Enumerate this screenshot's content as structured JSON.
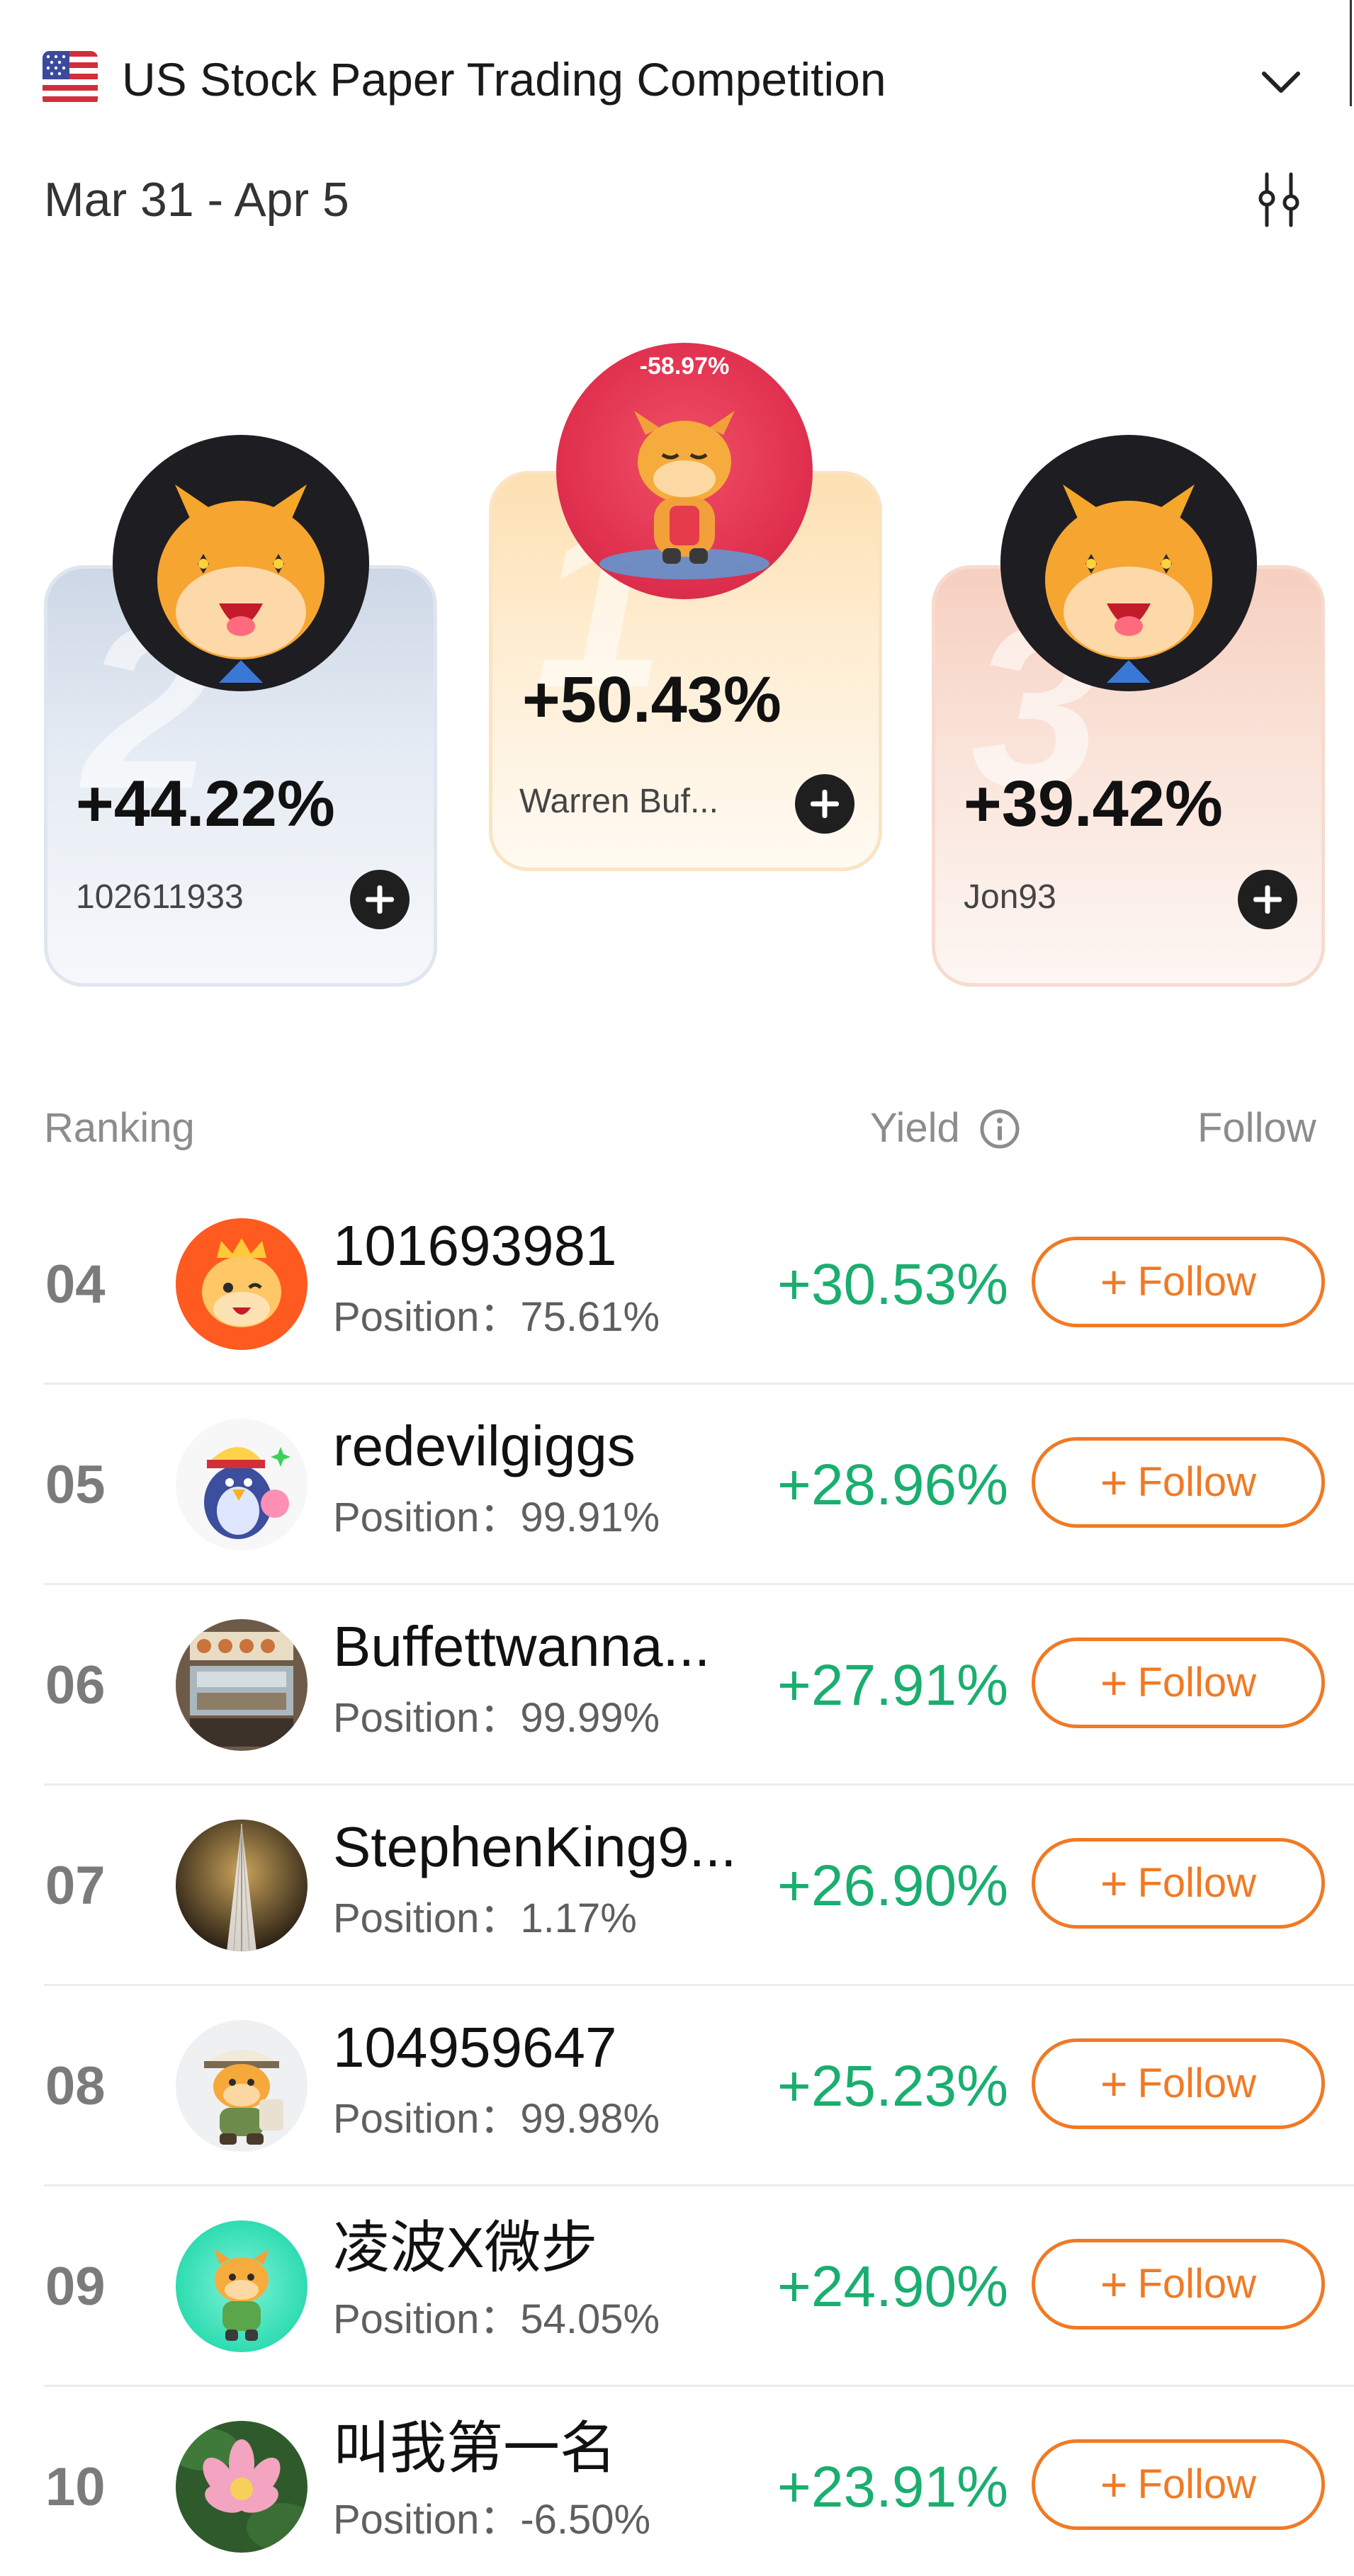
{
  "header": {
    "title": "US Stock Paper Trading Competition",
    "date_range": "Mar 31 - Apr 5",
    "flag_icon": "us-flag-icon",
    "dropdown_icon": "chevron-down-icon",
    "filter_icon": "sliders-icon"
  },
  "podium": [
    {
      "rank": "2",
      "yield": "+44.22%",
      "name": "102611933",
      "avatar": "bull-mascot-icon"
    },
    {
      "rank": "1",
      "yield": "+50.43%",
      "name": "Warren Buf...",
      "avatar": "bull-figure-image",
      "avatar_caption": "-58.97%"
    },
    {
      "rank": "3",
      "yield": "+39.42%",
      "name": "Jon93",
      "avatar": "bull-mascot-icon"
    }
  ],
  "list_header": {
    "ranking": "Ranking",
    "yield": "Yield",
    "follow": "Follow"
  },
  "position_label": "Position：",
  "follow_label": "Follow",
  "rows": [
    {
      "rank": "04",
      "name": "101693981",
      "position": "75.61%",
      "yield": "+30.53%"
    },
    {
      "rank": "05",
      "name": "redevilgiggs",
      "position": "99.91%",
      "yield": "+28.96%"
    },
    {
      "rank": "06",
      "name": "Buffettwanna...",
      "position": "99.99%",
      "yield": "+27.91%"
    },
    {
      "rank": "07",
      "name": "StephenKing9...",
      "position": "1.17%",
      "yield": "+26.90%"
    },
    {
      "rank": "08",
      "name": "104959647",
      "position": "99.98%",
      "yield": "+25.23%"
    },
    {
      "rank": "09",
      "name": "凌波X微步",
      "position": "54.05%",
      "yield": "+24.90%"
    },
    {
      "rank": "10",
      "name": "叫我第一名",
      "position": "-6.50%",
      "yield": "+23.91%"
    }
  ],
  "colors": {
    "gain": "#1aae6f",
    "follow": "#f07a25",
    "text": "#111111",
    "muted": "#8c8c8c"
  }
}
